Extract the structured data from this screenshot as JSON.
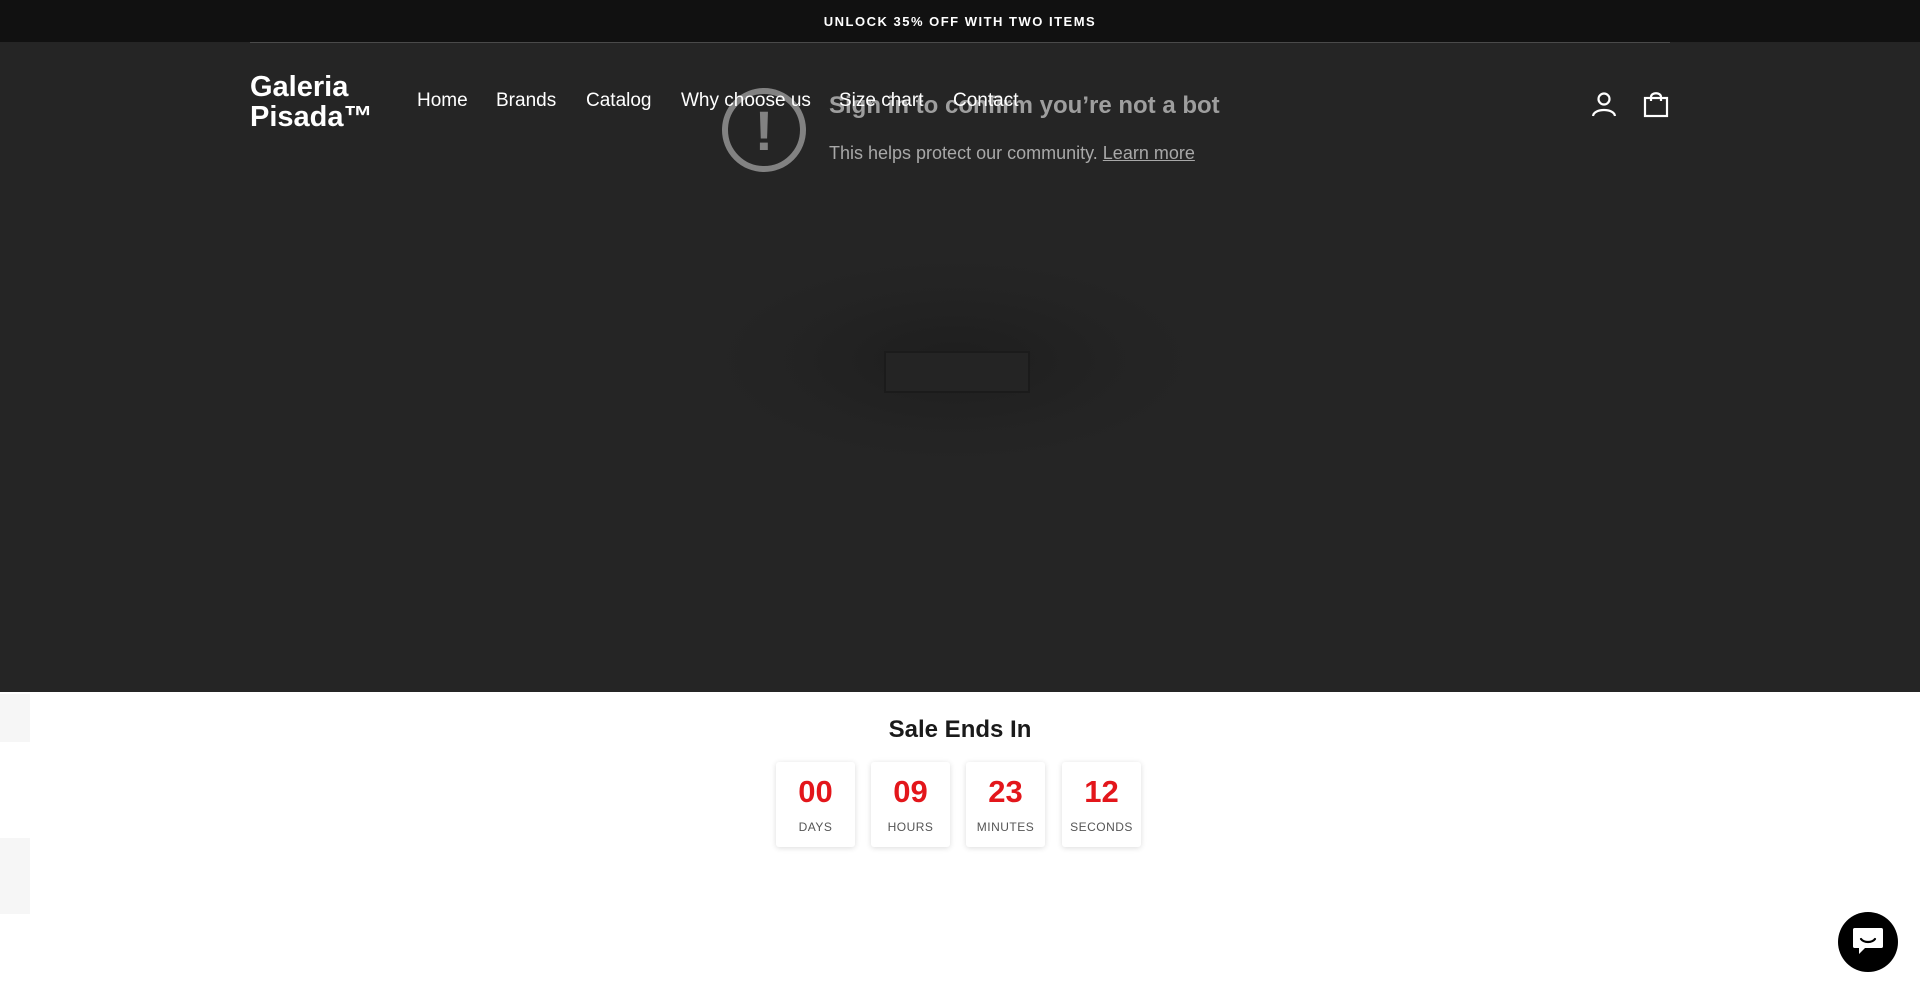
{
  "announcement": {
    "text": "UNLOCK 35% OFF WITH TWO ITEMS"
  },
  "header": {
    "logo": "Galeria Pisada™",
    "nav": [
      "Home",
      "Brands",
      "Catalog",
      "Why choose us",
      "Size chart",
      "Contact"
    ],
    "icons": {
      "account": "user-icon",
      "cart": "shopping-bag-icon"
    }
  },
  "overlay": {
    "icon": "exclamation-circle-icon",
    "title": "Sign in to confirm you’re not a bot",
    "subtitle": "This helps protect our community.",
    "link": "Learn more"
  },
  "countdown": {
    "title": "Sale Ends In",
    "units": [
      {
        "value": "00",
        "label": "DAYS"
      },
      {
        "value": "09",
        "label": "HOURS"
      },
      {
        "value": "23",
        "label": "MINUTES"
      },
      {
        "value": "12",
        "label": "SECONDS"
      }
    ],
    "value_color": "#e3161b"
  },
  "chat": {
    "icon": "chat-bubble-icon"
  },
  "colors": {
    "hero_bg": "#252525",
    "announcement_bg": "#111111",
    "accent": "#e3161b"
  }
}
